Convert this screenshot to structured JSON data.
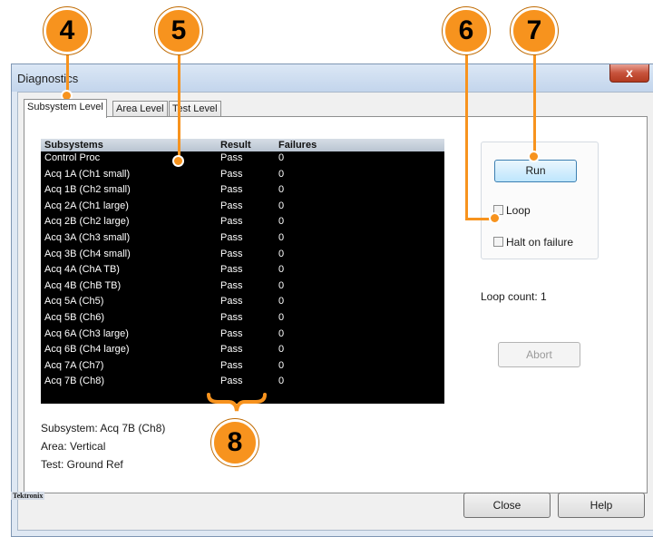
{
  "window": {
    "title": "Diagnostics",
    "close_glyph": "x"
  },
  "tabs": [
    {
      "label": "Subsystem Level",
      "active": true
    },
    {
      "label": "Area Level",
      "active": false
    },
    {
      "label": "Test Level",
      "active": false
    }
  ],
  "list": {
    "headers": [
      "Subsystems",
      "Result",
      "Failures"
    ],
    "rows": [
      [
        "Control Proc",
        "Pass",
        "0"
      ],
      [
        "Acq 1A (Ch1 small)",
        "Pass",
        "0"
      ],
      [
        "Acq 1B (Ch2 small)",
        "Pass",
        "0"
      ],
      [
        "Acq 2A (Ch1 large)",
        "Pass",
        "0"
      ],
      [
        "Acq 2B (Ch2 large)",
        "Pass",
        "0"
      ],
      [
        "Acq 3A (Ch3 small)",
        "Pass",
        "0"
      ],
      [
        "Acq 3B (Ch4 small)",
        "Pass",
        "0"
      ],
      [
        "Acq 4A (ChA TB)",
        "Pass",
        "0"
      ],
      [
        "Acq 4B (ChB TB)",
        "Pass",
        "0"
      ],
      [
        "Acq 5A (Ch5)",
        "Pass",
        "0"
      ],
      [
        "Acq 5B (Ch6)",
        "Pass",
        "0"
      ],
      [
        "Acq 6A (Ch3 large)",
        "Pass",
        "0"
      ],
      [
        "Acq 6B (Ch4 large)",
        "Pass",
        "0"
      ],
      [
        "Acq 7A (Ch7)",
        "Pass",
        "0"
      ],
      [
        "Acq 7B (Ch8)",
        "Pass",
        "0"
      ]
    ]
  },
  "info": {
    "subsystem": "Subsystem: Acq 7B (Ch8)",
    "area": "Area: Vertical",
    "test": "Test: Ground Ref"
  },
  "controls": {
    "run_label": "Run",
    "loop_label": "Loop",
    "loop_checked": false,
    "halt_label": "Halt on failure",
    "halt_checked": false,
    "loop_count": "Loop count: 1",
    "abort_label": "Abort"
  },
  "footer": {
    "logo_text": "Tektronix",
    "close_label": "Close",
    "help_label": "Help"
  },
  "callouts": [
    "4",
    "5",
    "6",
    "7",
    "8"
  ],
  "colors": {
    "callout": "#f7931e",
    "list_bg": "#000000",
    "list_text": "#ffffff"
  }
}
